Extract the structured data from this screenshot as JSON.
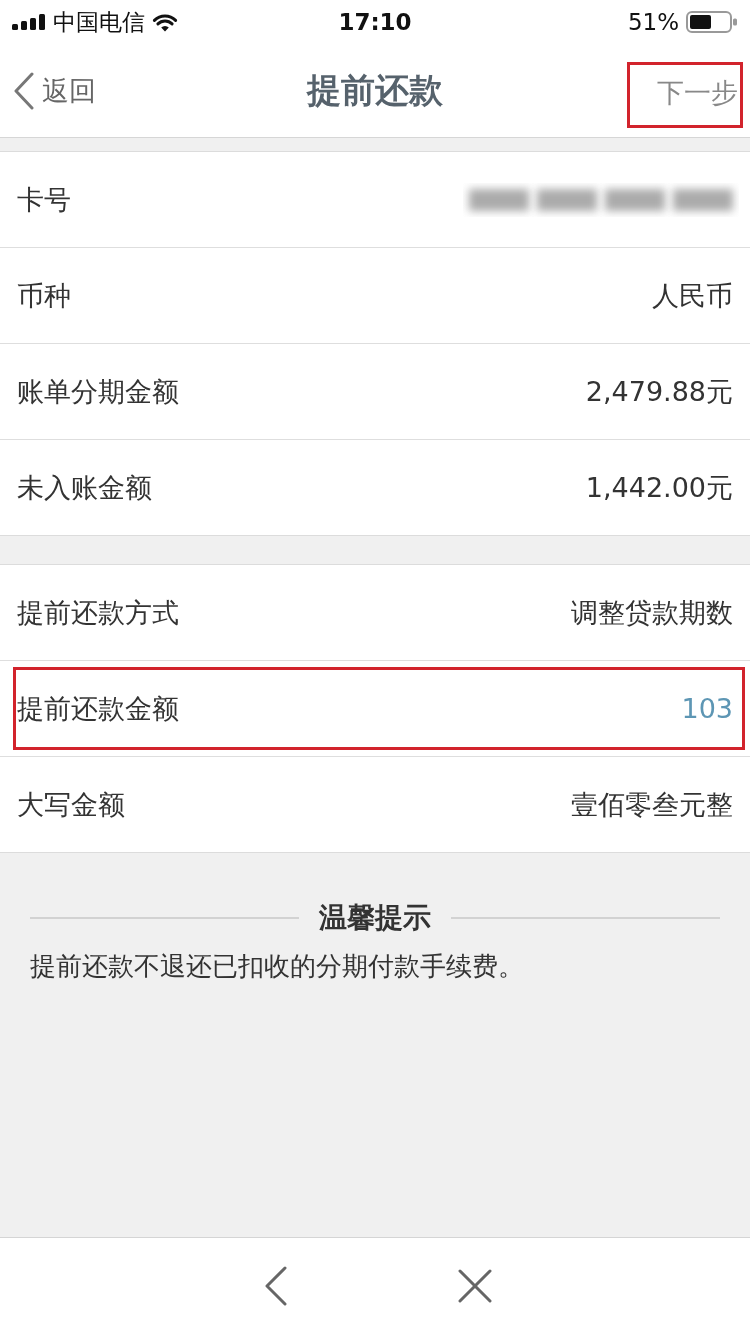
{
  "status_bar": {
    "carrier": "中国电信",
    "time": "17:10",
    "battery": "51%"
  },
  "nav_bar": {
    "back": "返回",
    "title": "提前还款",
    "next": {
      "label": "下一步",
      "highlighted": true
    }
  },
  "sections": [
    {
      "rows": [
        {
          "kind": "masked",
          "label": "卡号",
          "highlighted": false
        },
        {
          "kind": "text",
          "label": "币种",
          "value": "人民币",
          "highlighted": false
        },
        {
          "kind": "text",
          "label": "账单分期金额",
          "value": "2,479.88元",
          "highlighted": false
        },
        {
          "kind": "text",
          "label": "未入账金额",
          "value": "1,442.00元",
          "highlighted": false
        }
      ]
    },
    {
      "rows": [
        {
          "kind": "text",
          "label": "提前还款方式",
          "value": "调整贷款期数",
          "highlighted": false
        },
        {
          "kind": "input",
          "label": "提前还款金额",
          "value": "103",
          "highlighted": true
        },
        {
          "kind": "text",
          "label": "大写金额",
          "value": "壹佰零叁元整",
          "highlighted": false
        }
      ]
    }
  ],
  "tips": {
    "title": "温馨提示",
    "text": "提前还款不退还已扣收的分期付款手续费。"
  }
}
